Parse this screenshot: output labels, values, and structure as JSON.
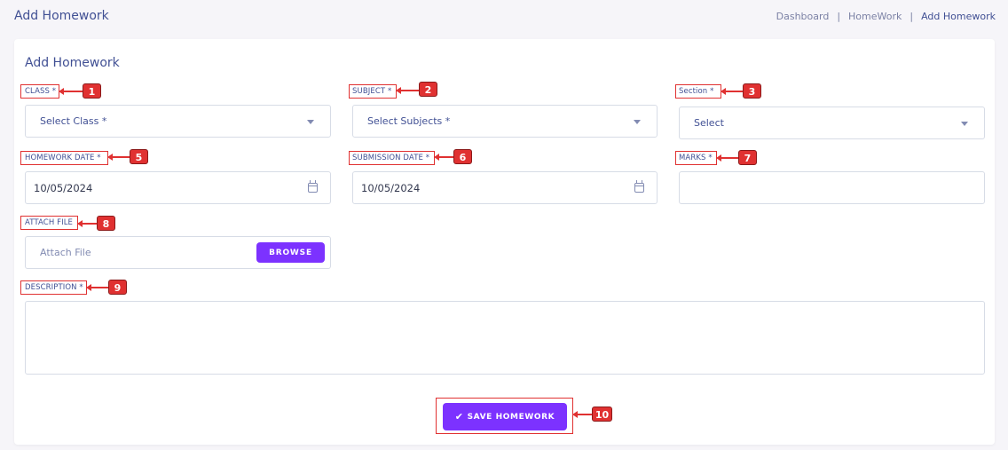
{
  "header": {
    "title": "Add Homework",
    "breadcrumb": [
      "Dashboard",
      "HomeWork",
      "Add Homework"
    ],
    "separator": "|"
  },
  "form": {
    "title": "Add Homework",
    "class": {
      "label": "CLASS *",
      "value": "Select Class *",
      "badge": "1"
    },
    "subject": {
      "label": "SUBJECT *",
      "value": "Select Subjects *",
      "badge": "2"
    },
    "section": {
      "label": "Section *",
      "value": "Select",
      "badge": "3"
    },
    "homework_date": {
      "label": "HOMEWORK DATE *",
      "value": "10/05/2024",
      "badge": "5"
    },
    "submission_date": {
      "label": "SUBMISSION DATE *",
      "value": "10/05/2024",
      "badge": "6"
    },
    "marks": {
      "label": "MARKS *",
      "value": "",
      "badge": "7"
    },
    "attach_file": {
      "label": "ATTACH FILE",
      "placeholder": "Attach File",
      "browse": "BROWSE",
      "badge": "8"
    },
    "description": {
      "label": "DESCRIPTION *",
      "value": "",
      "badge": "9"
    },
    "save": {
      "label": "SAVE HOMEWORK",
      "icon": "check-icon",
      "check": "✔",
      "badge": "10"
    }
  },
  "colors": {
    "accent": "#7c32ff",
    "text": "#415094",
    "annotation": "#e03131",
    "background": "#f6f5f9"
  }
}
